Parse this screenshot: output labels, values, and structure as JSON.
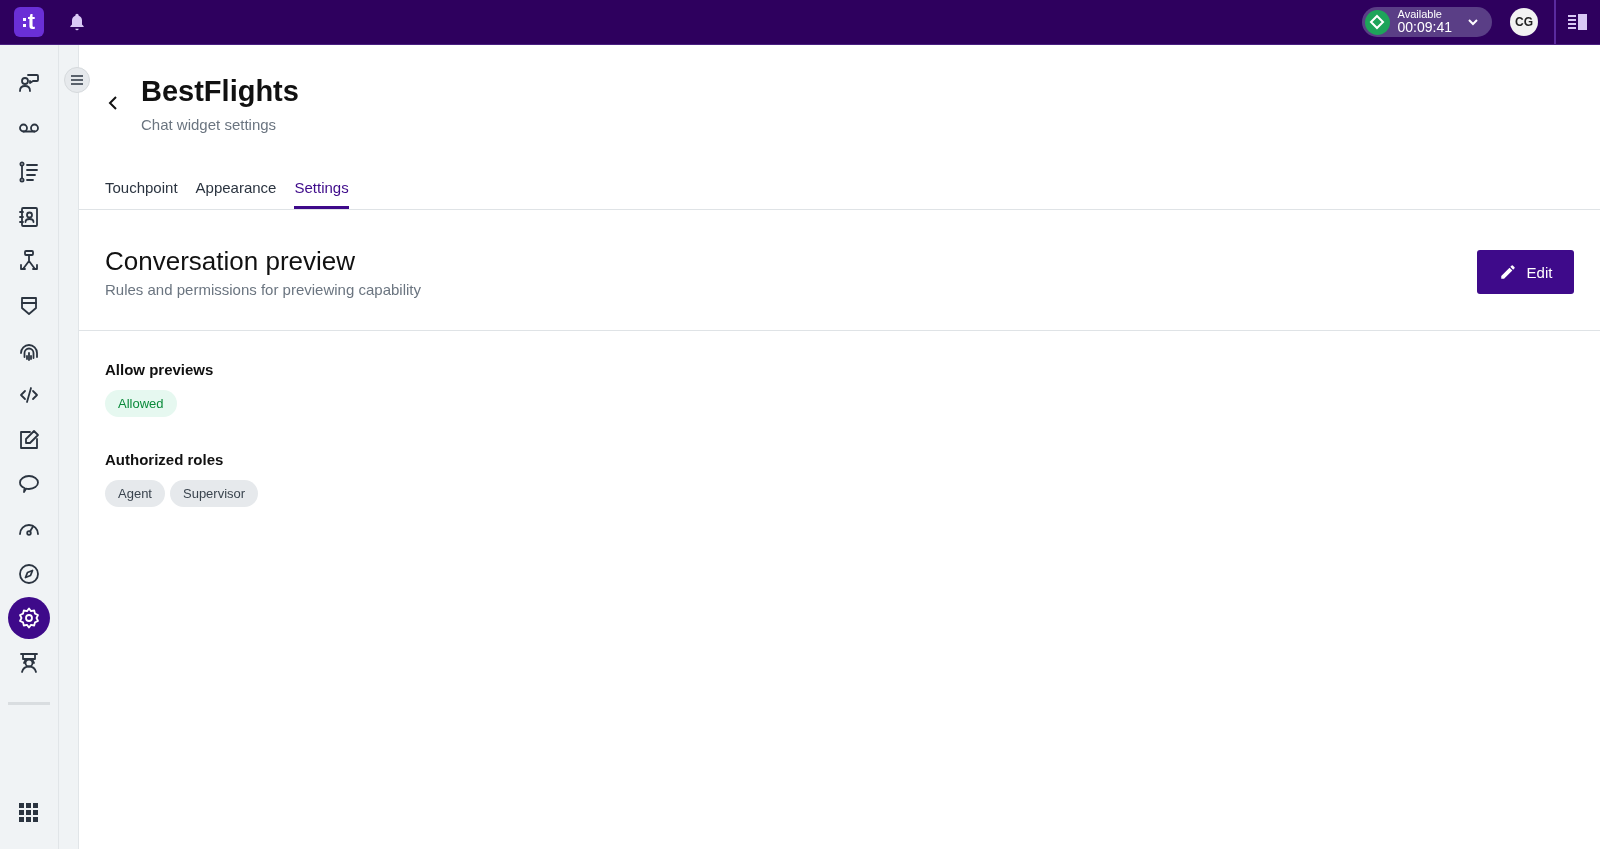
{
  "topbar": {
    "logo": "t",
    "status": {
      "label": "Available",
      "timer": "00:09:41"
    },
    "avatar": "CG"
  },
  "sidebar": {
    "items": [
      {
        "kind": "contacts",
        "selected": false
      },
      {
        "kind": "voicemail",
        "selected": false
      },
      {
        "kind": "list",
        "selected": false
      },
      {
        "kind": "directory",
        "selected": false
      },
      {
        "kind": "routing",
        "selected": false
      },
      {
        "kind": "shield",
        "selected": false
      },
      {
        "kind": "fingerprint",
        "selected": false
      },
      {
        "kind": "code",
        "selected": false
      },
      {
        "kind": "edit",
        "selected": false
      },
      {
        "kind": "chat",
        "selected": false
      },
      {
        "kind": "gauge",
        "selected": false
      },
      {
        "kind": "compass",
        "selected": false
      },
      {
        "kind": "settings",
        "selected": true
      },
      {
        "kind": "agent",
        "selected": false
      }
    ]
  },
  "header": {
    "title": "BestFlights",
    "subtitle": "Chat widget settings"
  },
  "tabs": [
    {
      "label": "Touchpoint",
      "selected": false
    },
    {
      "label": "Appearance",
      "selected": false
    },
    {
      "label": "Settings",
      "selected": true
    }
  ],
  "section": {
    "title": "Conversation preview",
    "description": "Rules and permissions for previewing capability",
    "edit_button": "Edit"
  },
  "fields": [
    {
      "label": "Allow previews",
      "chips": [
        {
          "text": "Allowed",
          "kind": "success"
        }
      ]
    },
    {
      "label": "Authorized roles",
      "chips": [
        {
          "text": "Agent",
          "kind": "neutral"
        },
        {
          "text": "Supervisor",
          "kind": "neutral"
        }
      ]
    }
  ]
}
